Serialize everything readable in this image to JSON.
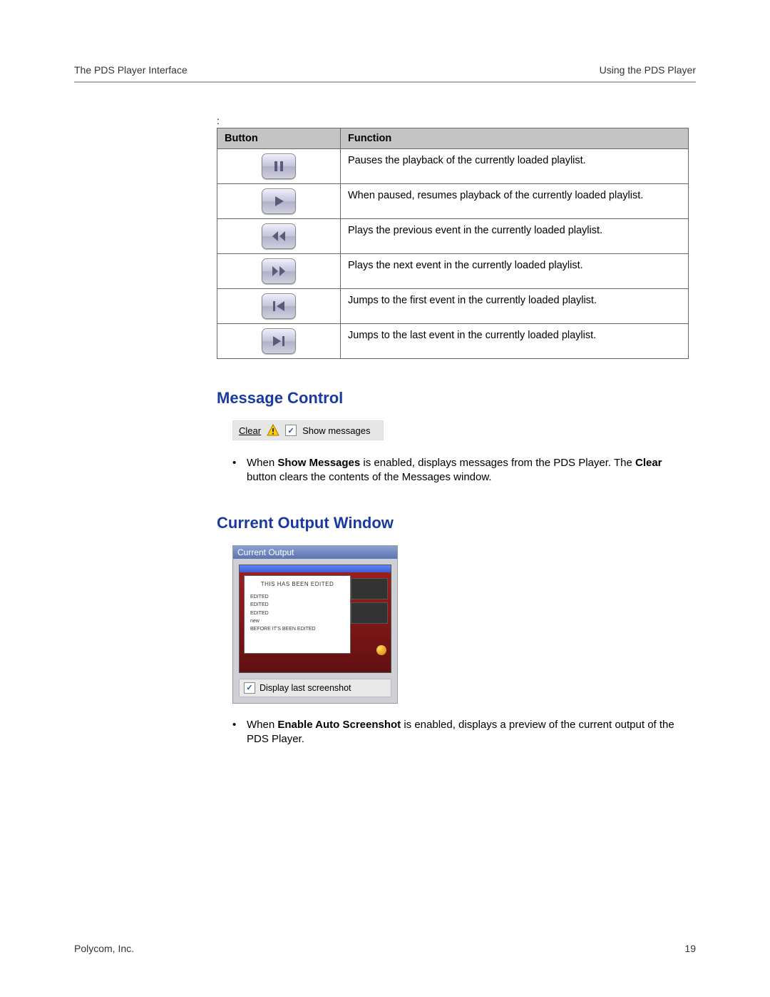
{
  "header": {
    "left": "The PDS Player Interface",
    "right": "Using the PDS Player"
  },
  "colon": ":",
  "table": {
    "col1": "Button",
    "col2": "Function",
    "rows": [
      {
        "icon": "pause",
        "func": "Pauses the playback of the currently loaded playlist."
      },
      {
        "icon": "play",
        "func": "When paused, resumes playback of the currently loaded playlist."
      },
      {
        "icon": "rewind",
        "func": "Plays the previous event in the currently loaded playlist."
      },
      {
        "icon": "fast-forward",
        "func": "Plays the next event in the currently loaded playlist."
      },
      {
        "icon": "skip-first",
        "func": "Jumps to the first event in the currently loaded playlist."
      },
      {
        "icon": "skip-last",
        "func": "Jumps to the last event in the currently loaded playlist."
      }
    ]
  },
  "section1": {
    "title": "Message Control",
    "clear": "Clear",
    "show_messages": "Show messages",
    "bullet_prefix": "When ",
    "bullet_bold1": "Show Messages",
    "bullet_mid": " is enabled, displays messages from the PDS Player. The ",
    "bullet_bold2": "Clear",
    "bullet_suffix": " button clears the contents of the Messages window."
  },
  "section2": {
    "title": "Current Output Window",
    "window_title": "Current Output",
    "doc_title": "THIS HAS BEEN EDITED",
    "doc_lines": [
      "EDITED",
      "EDITED",
      "EDITED",
      "new",
      "BEFORE IT'S BEEN EDITED"
    ],
    "checkbox_label": "Display last screenshot",
    "bullet_prefix": "When ",
    "bullet_bold": "Enable Auto Screenshot",
    "bullet_suffix": " is enabled, displays a preview of the current output of  the PDS Player."
  },
  "footer": {
    "left": "Polycom, Inc.",
    "right": "19"
  }
}
